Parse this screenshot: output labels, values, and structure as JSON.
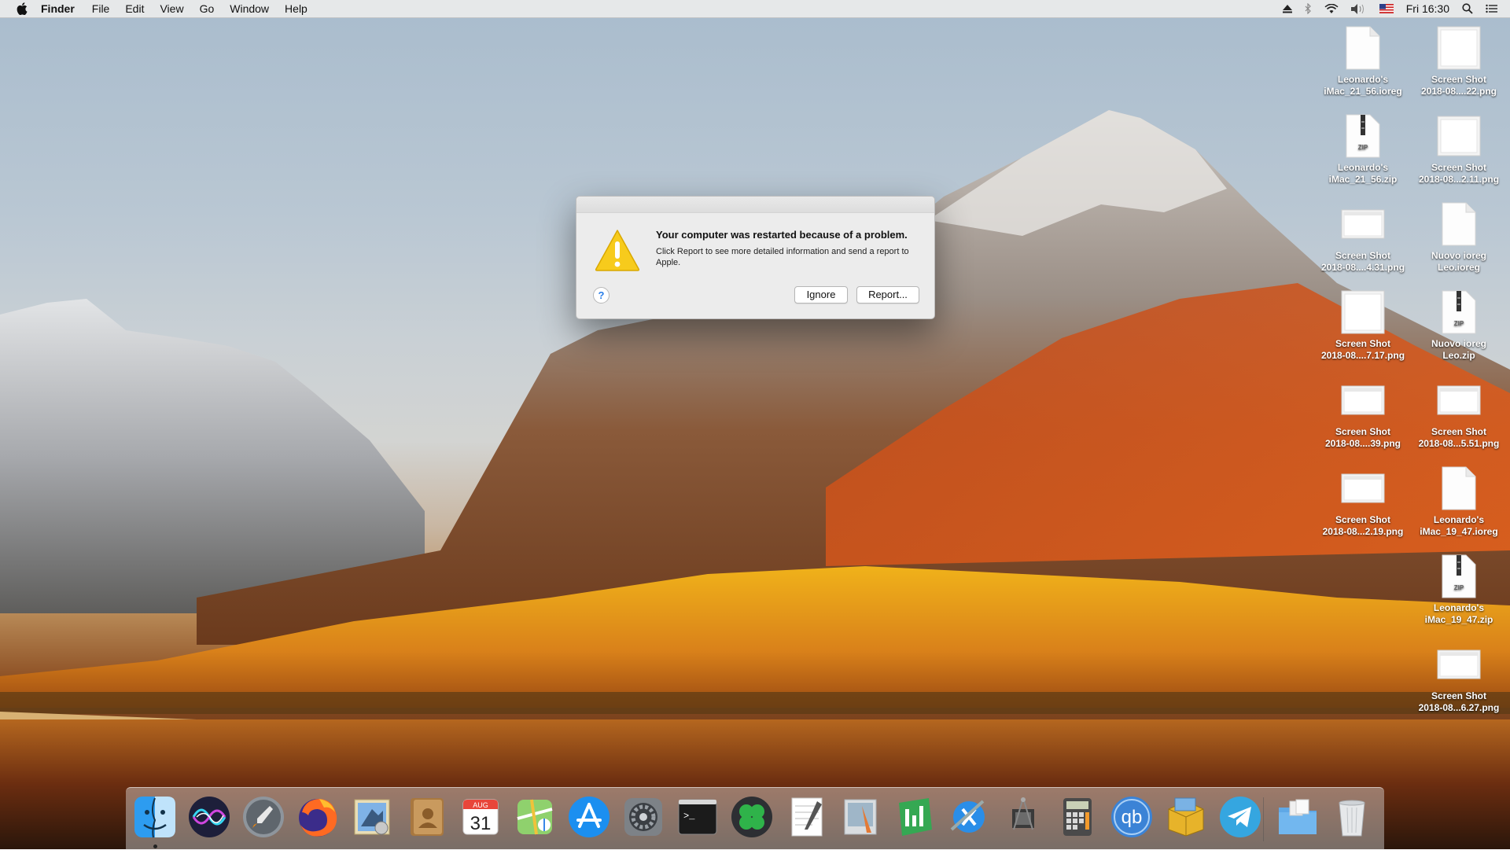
{
  "menubar": {
    "app_name": "Finder",
    "items": [
      "File",
      "Edit",
      "View",
      "Go",
      "Window",
      "Help"
    ],
    "clock": "Fri 16:30",
    "status_icons": [
      "eject-icon",
      "bluetooth-icon",
      "wifi-icon",
      "volume-icon",
      "us-flag-icon",
      "search-icon",
      "list-icon"
    ]
  },
  "desktop_icons": [
    {
      "line1": "Leonardo's",
      "line2": "iMac_21_56.ioreg",
      "type": "document"
    },
    {
      "line1": "Screen Shot",
      "line2": "2018-08....22.png",
      "type": "screenshot"
    },
    {
      "line1": "Leonardo's",
      "line2": "iMac_21_56.zip",
      "type": "zip"
    },
    {
      "line1": "Screen Shot",
      "line2": "2018-08...2.11.png",
      "type": "screenshot"
    },
    {
      "line1": "Screen Shot",
      "line2": "2018-08....4.31.png",
      "type": "screenshot-wide"
    },
    {
      "line1": "Nuovo ioreg",
      "line2": "Leo.ioreg",
      "type": "document"
    },
    {
      "line1": "Screen Shot",
      "line2": "2018-08....7.17.png",
      "type": "screenshot"
    },
    {
      "line1": "Nuovo ioreg",
      "line2": "Leo.zip",
      "type": "zip"
    },
    {
      "line1": "Screen Shot",
      "line2": "2018-08....39.png",
      "type": "screenshot-wide"
    },
    {
      "line1": "Screen Shot",
      "line2": "2018-08...5.51.png",
      "type": "screenshot-wide"
    },
    {
      "line1": "Screen Shot",
      "line2": "2018-08...2.19.png",
      "type": "screenshot-wide"
    },
    {
      "line1": "Leonardo's",
      "line2": "iMac_19_47.ioreg",
      "type": "document"
    },
    {
      "line1": "Leonardo's",
      "line2": "iMac_19_47.zip",
      "type": "zip"
    },
    {
      "line1": "Screen Shot",
      "line2": "2018-08...6.27.png",
      "type": "screenshot-wide"
    }
  ],
  "zip_label": "ZIP",
  "dialog": {
    "title": "Your computer was restarted because of a problem.",
    "message": "Click Report to see more detailed information and send a report to Apple.",
    "help": "?",
    "ignore_label": "Ignore",
    "report_label": "Report..."
  },
  "dock": {
    "apps": [
      "finder-icon",
      "siri-icon",
      "launchpad-icon",
      "firefox-icon",
      "mail-icon",
      "contacts-icon",
      "calendar-icon",
      "maps-icon",
      "app-store-icon",
      "system-preferences-icon",
      "terminal-icon",
      "clover-icon",
      "textedit-icon",
      "preview-icon",
      "numbers-icon",
      "xcode-icon",
      "system-info-icon",
      "calculator-icon",
      "qbittorrent-icon",
      "archive-utility-icon",
      "telegram-icon"
    ],
    "calendar_month": "AUG",
    "calendar_day": "31",
    "qb_label": "qb",
    "terminal_prompt": ">_",
    "downloads": "downloads-folder-icon",
    "trash": "trash-icon"
  },
  "colors": {
    "menubar_bg": "#ececec",
    "dialog_bg": "#ececec",
    "warning_yellow": "#f5c518",
    "link_blue": "#2a7ee8"
  }
}
